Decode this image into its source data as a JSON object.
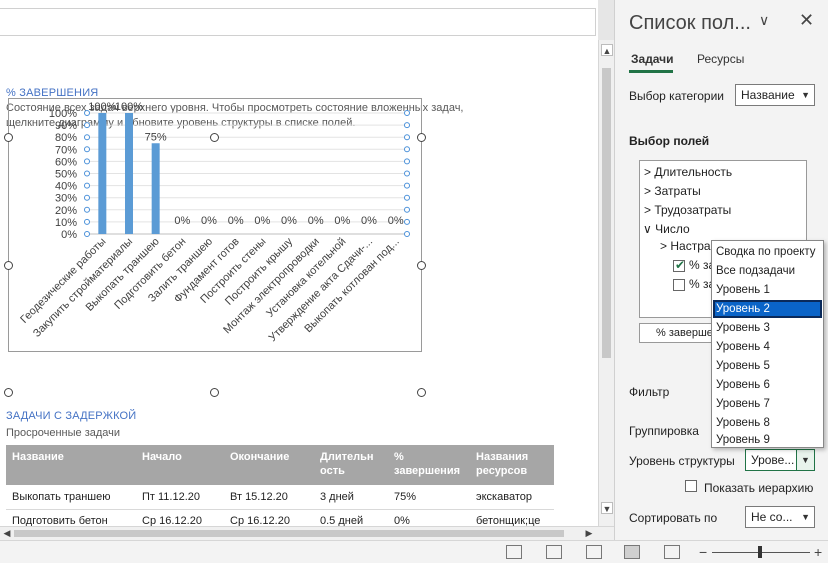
{
  "report": {
    "completion_title": "% ЗАВЕРШЕНИЯ",
    "completion_desc_line1": "Состояние всех задач верхнего уровня. Чтобы просмотреть состояние вложенных задач,",
    "completion_desc_line2": "щелкните диаграмму и обновите уровень структуры в списке полей.",
    "delayed_title": "ЗАДАЧИ С ЗАДЕРЖКОЙ",
    "delayed_desc": "Просроченные задачи",
    "table": {
      "headers": [
        [
          "Название"
        ],
        [
          "Начало"
        ],
        [
          "Окончание"
        ],
        [
          "Длительн",
          "ость"
        ],
        [
          "%",
          "завершения"
        ],
        [
          "Названия",
          "ресурсов"
        ]
      ],
      "rows": [
        [
          "Выкопать траншею",
          "Пт 11.12.20",
          "Вт 15.12.20",
          "3 дней",
          "75%",
          "экскаватор"
        ],
        [
          "Подготовить бетон",
          "Ср 16.12.20",
          "Ср 16.12.20",
          "0.5 дней",
          "0%",
          "бетонщик;це"
        ]
      ]
    }
  },
  "chart_data": {
    "type": "bar",
    "categories": [
      "Геодезические работы",
      "Закупить стройматериалы",
      "Выкопать траншею",
      "Подготовить бетон",
      "Залить траншею",
      "Фундамент готов",
      "Построить стены",
      "Построить крышу",
      "Монтаж электропроводки",
      "Установка котельной",
      "Утверждение акта Сдачи-...",
      "Выкопать котлован под..."
    ],
    "values": [
      100,
      100,
      75,
      0,
      0,
      0,
      0,
      0,
      0,
      0,
      0,
      0
    ],
    "data_labels": [
      "100%",
      "100%",
      "75%",
      "0%",
      "0%",
      "0%",
      "0%",
      "0%",
      "0%",
      "0%",
      "0%",
      "0%"
    ],
    "y_ticks": [
      "0%",
      "10%",
      "20%",
      "30%",
      "40%",
      "50%",
      "60%",
      "70%",
      "80%",
      "90%",
      "100%"
    ],
    "ylim": [
      0,
      100
    ],
    "bar_color": "#5b9bd5",
    "grid": true
  },
  "panel": {
    "title": "Список пол...",
    "tabs": [
      "Задачи",
      "Ресурсы"
    ],
    "category_label": "Выбор категории",
    "category_value": "Название",
    "fields_label": "Выбор полей",
    "tree": [
      "Длительность",
      "Затраты",
      "Трудозатраты",
      "Число",
      "Настра",
      "% за",
      "% за"
    ],
    "field_button": "% заверше",
    "filter_label": "Фильтр",
    "grouping_label": "Группировка",
    "outline_label": "Уровень структуры",
    "outline_value": "Урове...",
    "show_hierarchy": "Показать иерархию",
    "sort_label": "Сортировать по",
    "sort_value": "Не со...",
    "dropdown_items": [
      "Сводка по проекту",
      "Все подзадачи",
      "Уровень 1",
      "Уровень 2",
      "Уровень 3",
      "Уровень 4",
      "Уровень 5",
      "Уровень 6",
      "Уровень 7",
      "Уровень 8",
      "Уровень 9"
    ],
    "dropdown_selected": "Уровень 2"
  },
  "status": {
    "zoom_minus": "−",
    "zoom_plus": "+"
  }
}
